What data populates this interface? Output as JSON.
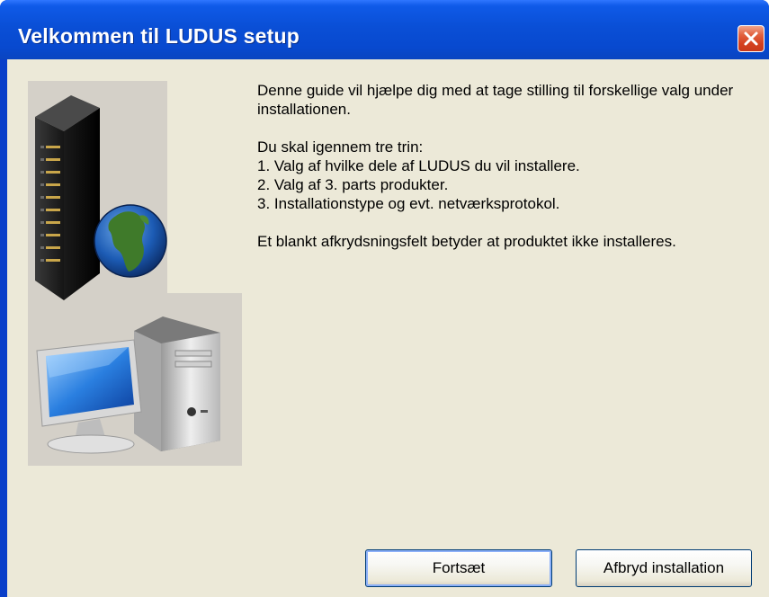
{
  "window": {
    "title": "Velkommen til LUDUS setup",
    "close_icon": "close-icon",
    "colors": {
      "titlebar": "#0a4fd6",
      "client": "#ece9d8",
      "close_button": "#d4401f"
    }
  },
  "illustration": {
    "icons": [
      "server-tower-icon",
      "globe-icon",
      "desktop-computer-icon"
    ],
    "background": "#d4d0c8"
  },
  "content": {
    "intro": "Denne guide vil hjælpe dig med at tage stilling til forskellige valg under installationen.",
    "steps_intro": "Du skal igennem tre trin:",
    "steps": [
      "1. Valg af hvilke dele af LUDUS du vil installere.",
      "2. Valg af 3. parts produkter.",
      "3. Installationstype og evt. netværksprotokol."
    ],
    "note": "Et blankt afkrydsningsfelt betyder at produktet ikke installeres."
  },
  "buttons": {
    "continue_label": "Fortsæt",
    "cancel_label": "Afbryd installation"
  }
}
